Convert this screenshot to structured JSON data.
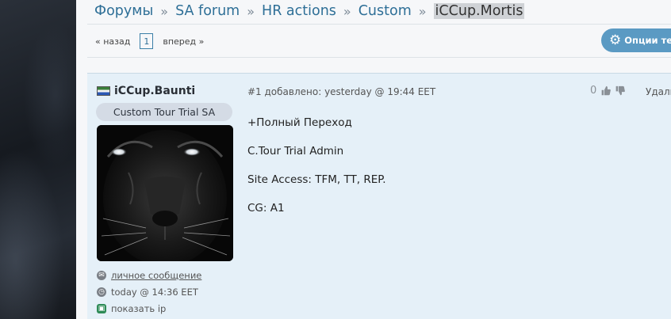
{
  "breadcrumb": {
    "items": [
      "Форумы",
      "SA forum",
      "HR actions",
      "Custom"
    ],
    "separator": "»",
    "current": "iCCup.Mortis"
  },
  "pager": {
    "prev_label": "« назад",
    "current_page": "1",
    "next_label": "вперед »"
  },
  "topic_options": {
    "label": "Опции темы",
    "icon": "gear-icon"
  },
  "post": {
    "author": {
      "name": "iCCup.Baunti",
      "flag_icon": "flag-icon",
      "rank": "Custom Tour Trial SA",
      "pm_label": "личное сообщение",
      "last_seen": "today @ 14:36 EET",
      "show_ip_label": "показать ip"
    },
    "header": "#1 добавлено: yesterday @ 19:44 EET",
    "vote_count": "0",
    "delete_label": "Удалить",
    "lines": [
      "+Полный Переход",
      "C.Tour Trial Admin",
      "Site Access: TFM, TT, REP.",
      "CG: A1"
    ]
  },
  "colors": {
    "link": "#2e6f97",
    "post_bg": "#e5f0f8",
    "button_bg": "#5b9ac3"
  }
}
